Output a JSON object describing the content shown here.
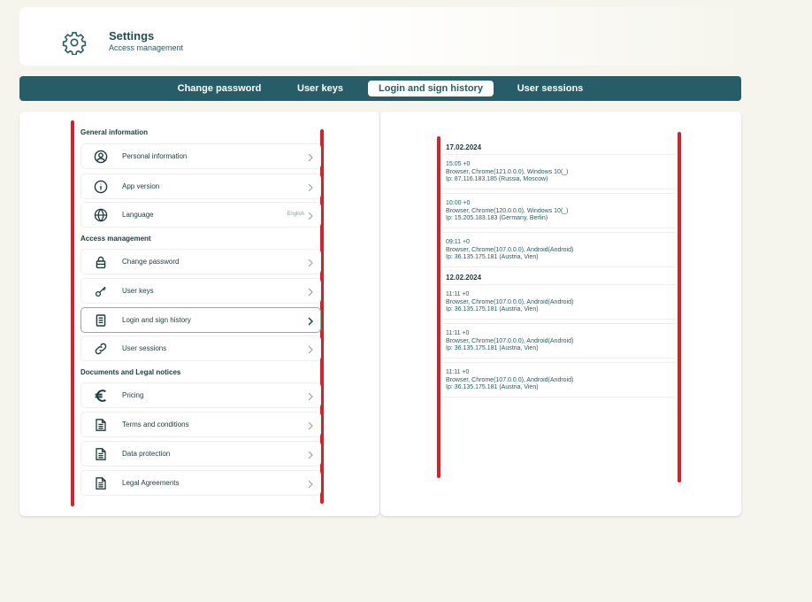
{
  "header": {
    "title": "Settings",
    "subtitle": "Access management"
  },
  "tabs": [
    {
      "label": "Change password",
      "active": false
    },
    {
      "label": "User keys",
      "active": false
    },
    {
      "label": "Login and sign history",
      "active": true
    },
    {
      "label": "User sessions",
      "active": false
    }
  ],
  "sections": [
    {
      "title": "General information",
      "items": [
        {
          "label": "Personal information",
          "icon": "user-circle-icon"
        },
        {
          "label": "App version",
          "icon": "info-icon"
        },
        {
          "label": "Language",
          "icon": "globe-icon",
          "value": "English"
        }
      ]
    },
    {
      "title": "Access management",
      "items": [
        {
          "label": "Change password",
          "icon": "lock-icon"
        },
        {
          "label": "User keys",
          "icon": "key-icon"
        },
        {
          "label": "Login and sign history",
          "icon": "document-icon",
          "active": true
        },
        {
          "label": "User sessions",
          "icon": "link-icon"
        }
      ]
    },
    {
      "title": "Documents and Legal notices",
      "items": [
        {
          "label": "Pricing",
          "icon": "euro-icon"
        },
        {
          "label": "Terms and conditions",
          "icon": "file-text-icon"
        },
        {
          "label": "Data protection",
          "icon": "file-text-icon"
        },
        {
          "label": "Legal Agreements",
          "icon": "file-text-icon"
        }
      ]
    }
  ],
  "history": [
    {
      "date": "17.02.2024",
      "entries": [
        {
          "time": "15:05 +0",
          "browser": "Browser, Chrome(121.0.0.0), Windows 10(_)",
          "ip": "Ip: 87.116.183.185 (Russia, Moscow)"
        },
        {
          "time": "10:00 +0",
          "browser": "Browser, Chrome(120.0.0.0), Windows 10(_)",
          "ip": "Ip: 15.205.183.183 (Germany, Berlin)"
        },
        {
          "time": "09:11 +0",
          "browser": "Browser, Chrome(107.0.0.0), Android(Android)",
          "ip": "Ip: 36.135.175.181 (Austria, Vien)"
        }
      ]
    },
    {
      "date": "12.02.2024",
      "entries": [
        {
          "time": "11:11 +0",
          "browser": "Browser, Chrome(107.0.0.0), Android(Android)",
          "ip": "Ip: 36.135.175.181 (Austria, Vien)"
        },
        {
          "time": "11:11 +0",
          "browser": "Browser, Chrome(107.0.0.0), Android(Android)",
          "ip": "Ip: 36.135.175.181 (Austria, Vien)"
        },
        {
          "time": "11:11 +0",
          "browser": "Browser, Chrome(107.0.0.0), Android(Android)",
          "ip": "Ip: 36.135.175.181 (Austria, Vien)"
        }
      ]
    }
  ],
  "colors": {
    "accent": "#275d66",
    "background": "#f6f5ed",
    "highlight": "#d9202a",
    "active_border": "#7ab89c"
  }
}
